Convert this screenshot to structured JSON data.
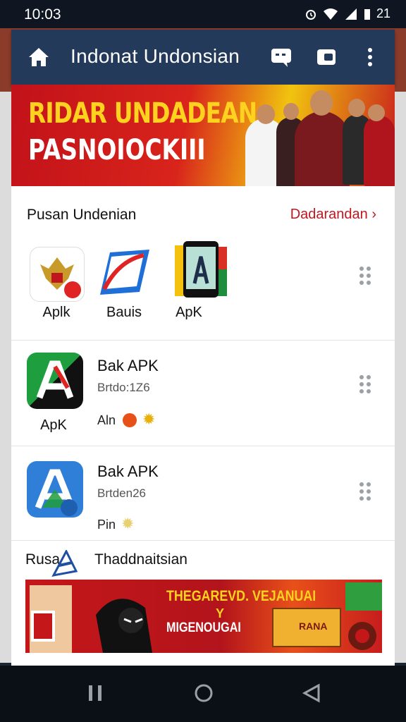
{
  "status": {
    "time": "10:03",
    "battery": "21"
  },
  "appbar": {
    "title": "Indonat Undonsian"
  },
  "banner": {
    "line1": "RIDAR UNDADEAN",
    "line2": "PASNOIOCKIII"
  },
  "section1": {
    "title": "Pusan Undenian",
    "link": "Dadarandan ›"
  },
  "featured_apps": [
    {
      "label": "Aplk"
    },
    {
      "label": "Bauis"
    },
    {
      "label": "ApK"
    }
  ],
  "list_items": [
    {
      "icon_label": "ApK",
      "name": "Bak APK",
      "sub": "Brtdo:1Z6",
      "meta": "Aln"
    },
    {
      "icon_label": "",
      "name": "Bak APK",
      "sub": "Brtden26",
      "meta": "Pin"
    }
  ],
  "section2": {
    "title_left": "Rusa",
    "title_right": "Thaddnaitsian"
  },
  "bottom_banner": {
    "line1": "THEGAREVD. VEJANUAI",
    "mid": "Y",
    "line2": "MIGENOUGAI",
    "badge": "RANA"
  },
  "colors": {
    "appbar": "#233a5a",
    "accent": "#c0171f",
    "banner_red": "#d8241b",
    "banner_yellow": "#ffd21f"
  }
}
